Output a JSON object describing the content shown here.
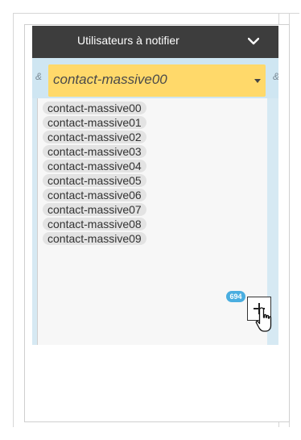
{
  "header": {
    "title": "Utilisateurs à notifier",
    "chevron_icon": "chevron-down-icon"
  },
  "filter": {
    "amp_left": "&",
    "amp_right": "&",
    "selected_value": "contact-massive00",
    "caret_icon": "caret-down-icon"
  },
  "contacts": [
    "contact-massive00",
    "contact-massive01",
    "contact-massive02",
    "contact-massive03",
    "contact-massive04",
    "contact-massive05",
    "contact-massive06",
    "contact-massive07",
    "contact-massive08",
    "contact-massive09"
  ],
  "more": {
    "count": "694",
    "add_icon": "plus-icon"
  },
  "colors": {
    "header_bg": "#3d3d3d",
    "select_bg": "#ffd96a",
    "badge_bg": "#4aaee0",
    "panel_bg": "#d6e9f3"
  }
}
